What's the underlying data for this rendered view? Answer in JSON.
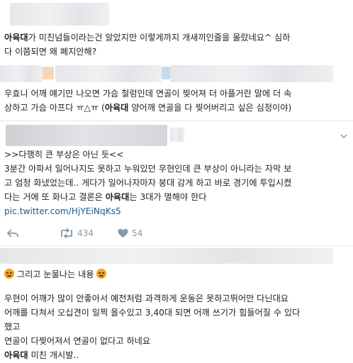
{
  "post1": {
    "line1_bold": "아육대",
    "line1_rest": "가 미친넘들이라는건 알았지만 이렇게까지 개새끼인줄을 몰랐네요^ 심하",
    "line2": "다 이쯤되면 왜 폐지안해?"
  },
  "post2": {
    "line1": "우효니 어깨 얘기만 나오면 가슴 철렁인데 연골이 찢어져 더 아플거란 말에 더 속",
    "line2_pre": "상하고 가슴 아프다 ㅠ△ㅠ (",
    "line2_bold": "아육대",
    "line2_post": " 양어깨 연골을 다 찢어버리고 싶은 심정이야)"
  },
  "tweet": {
    "line1": ">>다행히 큰 부상은 아닌 듯<<",
    "line2": "3분간 아파서 일어나지도 못하고 누워있던 우현인데 큰 부상이 아니라는 자막 보",
    "line3": "고 엄청 화냈었는데.. 게다가 일어나자마자 붕대 감게 하고 바로 경기에 투입시켰",
    "line4_pre": "다는 거에 또 화나고 결론은 ",
    "line4_bold": "아육대",
    "line4_post": "는 3대가 멸해야 한다",
    "link": "pic.twitter.com/HjYEiNqKs5",
    "retweets": "434",
    "likes": "54"
  },
  "post3": {
    "line1": "그리고 눈물나는 내용",
    "line2": "우현이 어깨가 많이 안좋아서 예전처럼 과격하게 운동은 못하고뛰어만 다닌대요",
    "line3": "어깨를 다쳐서 오십견이 일찍 올수있고 3,40대 되면 어깨 쓰기가 힘들어질 수 있다",
    "line4": "했고",
    "line5": "연골이 다찢어져서 연골이 없다고 하네요",
    "line6_bold": "아육대",
    "line6_rest": " 미친 개시발.."
  },
  "colors": {
    "link": "#1f5a8a",
    "action_gray": "#8899a6",
    "emoji": "#f2a22c"
  },
  "icons": [
    "reply-icon",
    "retweet-icon",
    "heart-icon",
    "angry-face-icon"
  ]
}
